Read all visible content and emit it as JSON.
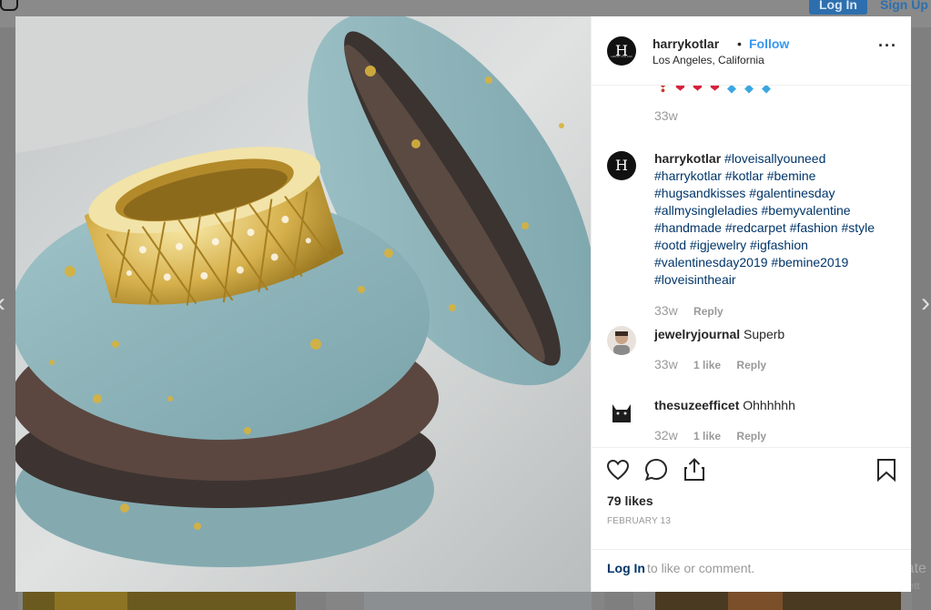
{
  "topbar": {
    "login_label": "Log In",
    "signup_label": "Sign Up"
  },
  "post": {
    "username": "harrykotlar",
    "separator": "•",
    "follow_label": "Follow",
    "location": "Los Angeles, California",
    "more_icon": "ellipsis-icon",
    "avatar_letter": "H",
    "avatar_subtext": "HARRY KOTLAR",
    "likes": "79 likes",
    "date": "FEBRUARY 13"
  },
  "comments": {
    "previous_time": "33w",
    "emoji_row": [
      "❣",
      "❤",
      "❤",
      "❤",
      "💎",
      "💎",
      "💎"
    ],
    "caption": {
      "username": "harrykotlar",
      "text": "#loveisallyouneed #harrykotlar #kotlar #bemine #hugsandkisses #galentinesday #allmysingleladies #bemyvalentine #handmade #redcarpet #fashion #style #ootd #igjewelry #igfashion #valentinesday2019 #bemine2019 #loveisintheair",
      "time": "33w",
      "reply": "Reply"
    },
    "items": [
      {
        "username": "jewelryjournal",
        "text": "Superb",
        "time": "33w",
        "likes": "1 like",
        "reply": "Reply"
      },
      {
        "username": "thesuzeefficet",
        "text": "Ohhhhhh",
        "time": "32w",
        "likes": "1 like",
        "reply": "Reply"
      }
    ]
  },
  "actions": {
    "like_icon": "heart-icon",
    "comment_icon": "comment-icon",
    "share_icon": "share-icon",
    "save_icon": "bookmark-icon"
  },
  "footer": {
    "login_link": "Log In",
    "login_rest": "to like or comment."
  },
  "watermark": {
    "line1": "Activate",
    "line2": "Go to Sett"
  },
  "colors": {
    "link": "#003569",
    "follow": "#3897f0",
    "muted": "#999999"
  }
}
